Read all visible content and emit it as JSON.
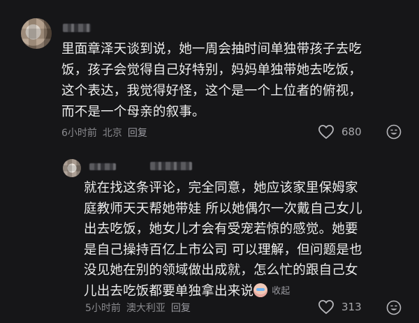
{
  "comment": {
    "text": "里面章泽天谈到说，她一周会抽时间单独带孩子去吃\n饭，孩子会觉得自己好特别，妈妈单独带她去吃饭，\n这个表达，我觉得好怪，这个是一个上位者的俯视，\n而不是一个母亲的叙事。",
    "time": "6小时前",
    "location": "北京",
    "reply_label": "回复",
    "likes": "680"
  },
  "reply": {
    "text": "就在找这条评论，完全同意，她应该家里保姆家\n庭教师天天帮她带娃 所以她偶尔一次戴自己女儿\n出去吃饭，她女儿才会有受宠若惊的感觉。她要\n是自己操持百亿上市公司 可以理解，但问题是也\n没见她在别的领域做出成就，怎么忙的跟自己女\n儿出去吃饭都要单独拿出来说",
    "collapse_label": "收起",
    "time": "5小时前",
    "location": "澳大利亚",
    "reply_label": "回复",
    "likes": "313"
  },
  "icons": {
    "like": "heart-outline-icon",
    "emoji": "smiley-icon",
    "inline": "crying-face-emoji"
  }
}
